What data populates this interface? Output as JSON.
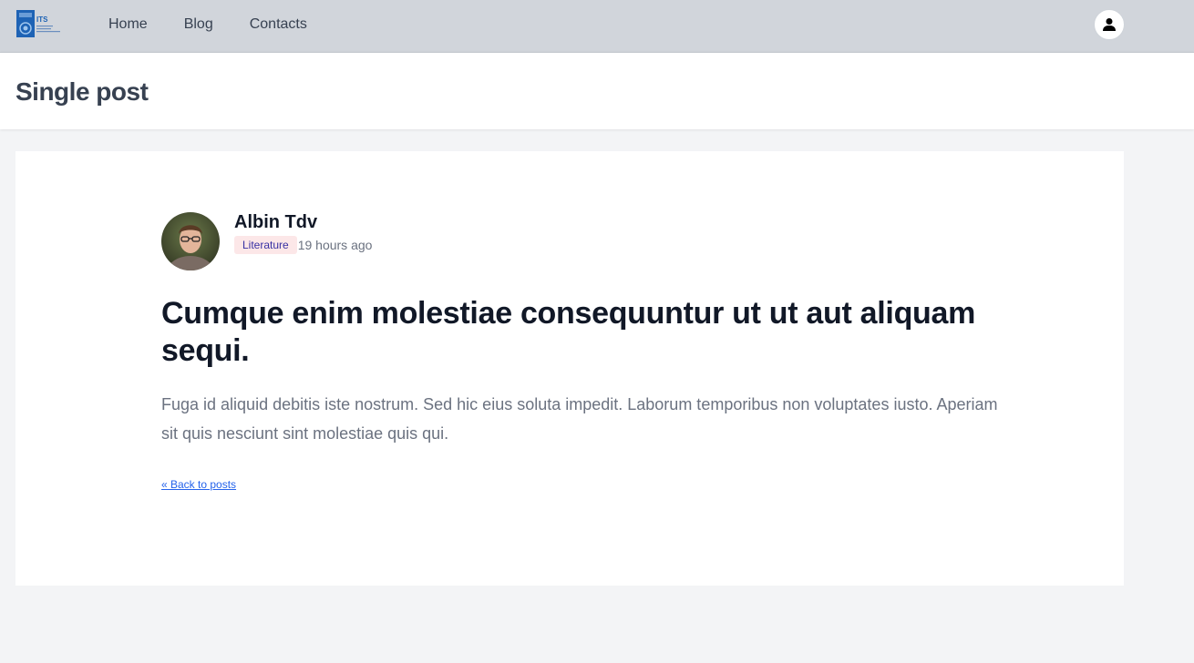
{
  "nav": {
    "links": [
      "Home",
      "Blog",
      "Contacts"
    ]
  },
  "header": {
    "title": "Single post"
  },
  "post": {
    "author": "Albin Tdv",
    "category": "Literature",
    "time_ago": "19 hours ago",
    "title": "Cumque enim molestiae consequuntur ut ut aut aliquam sequi.",
    "body": "Fuga id aliquid debitis iste nostrum. Sed hic eius soluta impedit. Laborum temporibus non voluptates iusto. Aperiam sit quis nesciunt sint molestiae quis qui.",
    "back_link": "« Back to posts"
  },
  "logo_text": "ITS",
  "colors": {
    "navbar": "#d1d5db",
    "link": "#2563eb",
    "badge_bg": "#fce7e8",
    "badge_text": "#3730a3"
  }
}
